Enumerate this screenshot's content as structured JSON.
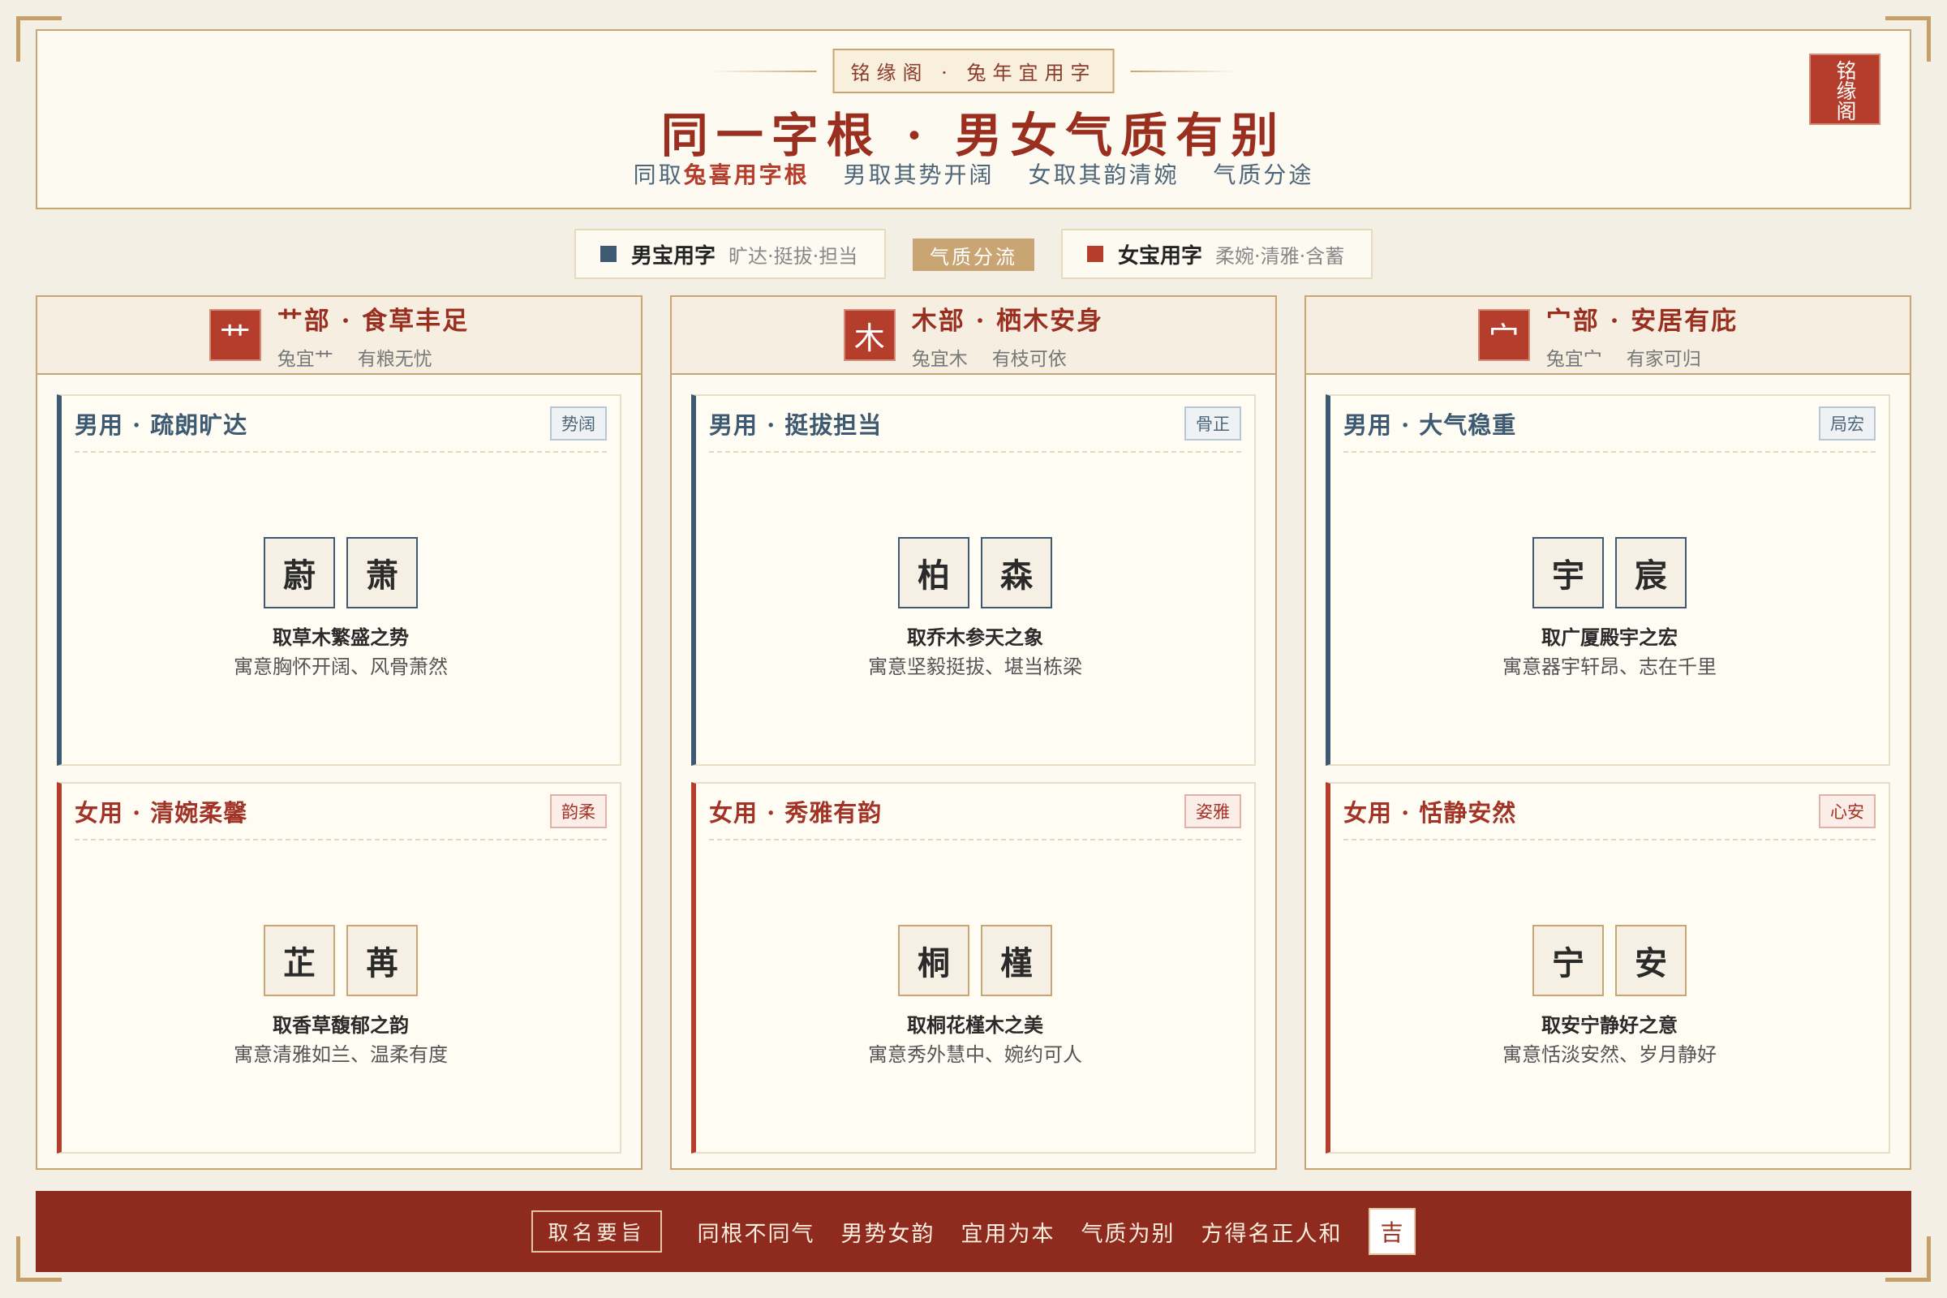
{
  "header": {
    "tagline": "铭缘阁 · 兔年宜用字",
    "title": "同一字根 · 男女气质有别",
    "subtitle_pre": "同取",
    "subtitle_highlight": "兔喜用字根",
    "subtitle_items": [
      "男取其势开阔",
      "女取其韵清婉",
      "气质分途"
    ],
    "seal": "铭缘阁"
  },
  "legend": {
    "male_label": "男宝用字",
    "male_desc": "旷达·挺拔·担当",
    "center": "气质分流",
    "female_label": "女宝用字",
    "female_desc": "柔婉·清雅·含蓄"
  },
  "colors": {
    "male": "#3d5a72",
    "female": "#b43d2b",
    "gold": "#c9a574",
    "footer": "#8f2a1e"
  },
  "columns": [
    {
      "radical": "艹",
      "title": "艹部 · 食草丰足",
      "sub1": "兔宜艹",
      "sub2": "有粮无忧",
      "male": {
        "title": "男用 · 疏朗旷达",
        "badge": "势阔",
        "chars": [
          "蔚",
          "萧"
        ],
        "note1": "取草木繁盛之势",
        "note2": "寓意胸怀开阔、风骨萧然"
      },
      "female": {
        "title": "女用 · 清婉柔馨",
        "badge": "韵柔",
        "chars": [
          "芷",
          "苒"
        ],
        "note1": "取香草馥郁之韵",
        "note2": "寓意清雅如兰、温柔有度"
      }
    },
    {
      "radical": "木",
      "title": "木部 · 栖木安身",
      "sub1": "兔宜木",
      "sub2": "有枝可依",
      "male": {
        "title": "男用 · 挺拔担当",
        "badge": "骨正",
        "chars": [
          "柏",
          "森"
        ],
        "note1": "取乔木参天之象",
        "note2": "寓意坚毅挺拔、堪当栋梁"
      },
      "female": {
        "title": "女用 · 秀雅有韵",
        "badge": "姿雅",
        "chars": [
          "桐",
          "槿"
        ],
        "note1": "取桐花槿木之美",
        "note2": "寓意秀外慧中、婉约可人"
      }
    },
    {
      "radical": "宀",
      "title": "宀部 · 安居有庇",
      "sub1": "兔宜宀",
      "sub2": "有家可归",
      "male": {
        "title": "男用 · 大气稳重",
        "badge": "局宏",
        "chars": [
          "宇",
          "宸"
        ],
        "note1": "取广厦殿宇之宏",
        "note2": "寓意器宇轩昂、志在千里"
      },
      "female": {
        "title": "女用 · 恬静安然",
        "badge": "心安",
        "chars": [
          "宁",
          "安"
        ],
        "note1": "取安宁静好之意",
        "note2": "寓意恬淡安然、岁月静好"
      }
    }
  ],
  "footer": {
    "key": "取名要旨",
    "phrases": [
      "同根不同气",
      "男势女韵",
      "宜用为本",
      "气质为别",
      "方得名正人和"
    ],
    "ji": "吉"
  }
}
